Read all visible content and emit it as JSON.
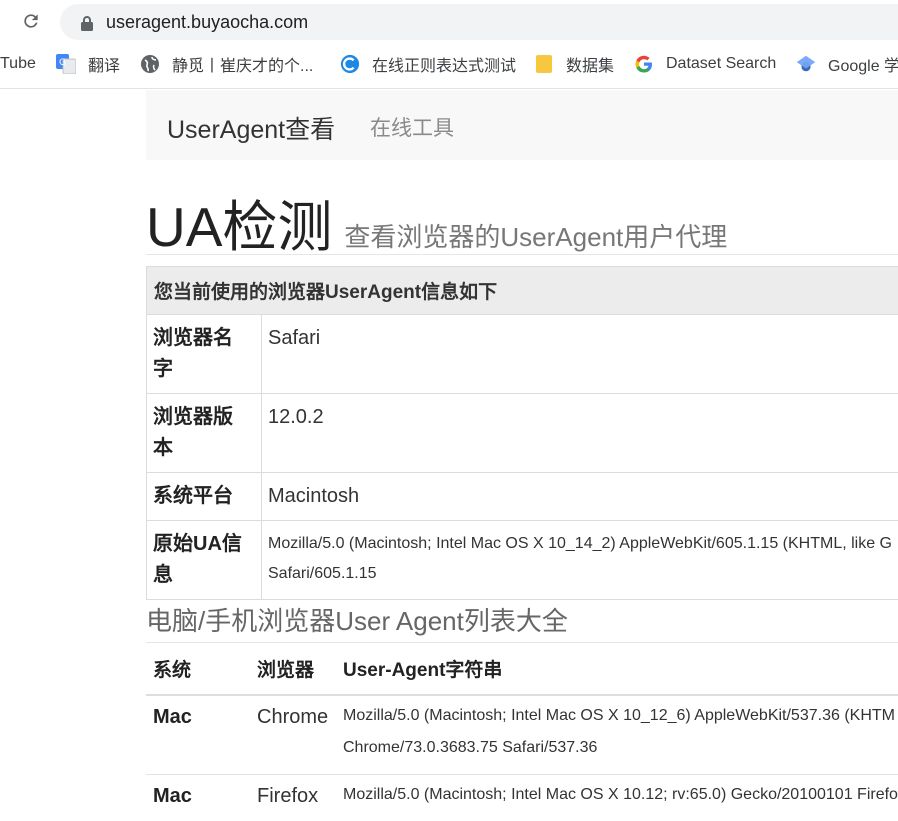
{
  "browser": {
    "url": "useragent.buyaocha.com",
    "bookmarks": [
      {
        "label": "Tube",
        "icon": "youtube-icon"
      },
      {
        "label": "翻译",
        "icon": "google-translate-icon"
      },
      {
        "label": "静觅丨崔庆才的个...",
        "icon": "globe-icon"
      },
      {
        "label": "在线正则表达式测试",
        "icon": "regex-site-icon"
      },
      {
        "label": "数据集",
        "icon": "folder-icon"
      },
      {
        "label": "Dataset Search",
        "icon": "google-g-icon"
      },
      {
        "label": "Google 学",
        "icon": "google-scholar-icon"
      }
    ]
  },
  "navbar": {
    "brand": "UserAgent查看",
    "link": "在线工具"
  },
  "heading": {
    "title": "UA检测",
    "subtitle": "查看浏览器的UserAgent用户代理"
  },
  "info_table": {
    "caption": "您当前使用的浏览器UserAgent信息如下",
    "rows": [
      {
        "key_line1": "浏览器名",
        "key_line2": "字",
        "value": "Safari"
      },
      {
        "key_line1": "浏览器版",
        "key_line2": "本",
        "value": "12.0.2"
      },
      {
        "key_line1": "系统平台",
        "key_line2": "",
        "value": "Macintosh"
      },
      {
        "key_line1": "原始UA信",
        "key_line2": "息",
        "value_line1": "Mozilla/5.0 (Macintosh; Intel Mac OS X 10_14_2) AppleWebKit/605.1.15 (KHTML, like G",
        "value_line2": "Safari/605.1.15"
      }
    ]
  },
  "list_section": {
    "title": "电脑/手机浏览器User Agent列表大全",
    "headers": [
      "系统",
      "浏览器",
      "User-Agent字符串"
    ],
    "rows": [
      {
        "os": "Mac",
        "browser": "Chrome",
        "ua_line1": "Mozilla/5.0 (Macintosh; Intel Mac OS X 10_12_6) AppleWebKit/537.36 (KHTM",
        "ua_line2": "Chrome/73.0.3683.75 Safari/537.36"
      },
      {
        "os": "Mac",
        "browser": "Firefox",
        "ua_line1": "Mozilla/5.0 (Macintosh; Intel Mac OS X 10.12; rv:65.0) Gecko/20100101 Firefo",
        "ua_line2": ""
      }
    ]
  },
  "colors": {
    "navbar_bg": "#f8f8f8",
    "caption_bg": "#ececec",
    "google_blue": "#4285f4",
    "folder_yellow": "#f6c842"
  }
}
